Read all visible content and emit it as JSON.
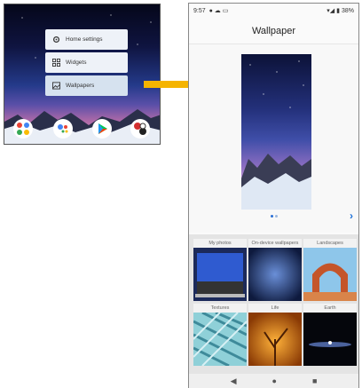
{
  "home_screen": {
    "menu": [
      {
        "label": "Home settings",
        "icon": "gear-icon"
      },
      {
        "label": "Widgets",
        "icon": "widgets-icon"
      },
      {
        "label": "Wallpapers",
        "icon": "wallpaper-icon",
        "selected": true
      }
    ],
    "dock": [
      "google-apps-folder-icon",
      "assistant-icon",
      "play-store-icon",
      "other-apps-icon"
    ]
  },
  "arrow_color": "#f5b400",
  "wallpaper_app": {
    "status": {
      "time": "9:57",
      "battery": "38%"
    },
    "title": "Wallpaper",
    "categories": [
      {
        "label": "My photos"
      },
      {
        "label": "On-device wallpapers"
      },
      {
        "label": "Landscapes"
      },
      {
        "label": "Textures"
      },
      {
        "label": "Life"
      },
      {
        "label": "Earth"
      }
    ],
    "accent": "#1a6fd8"
  }
}
